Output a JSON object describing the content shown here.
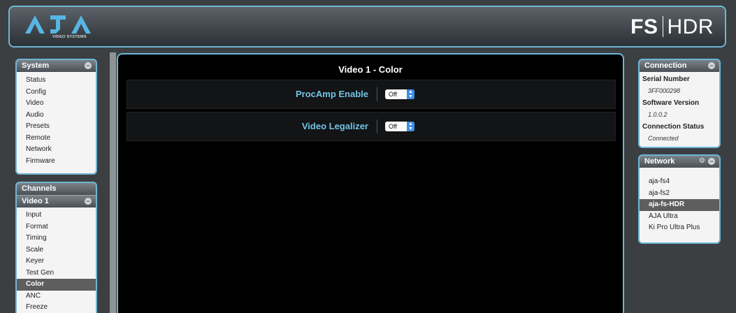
{
  "header": {
    "logo_text": "AJA",
    "logo_subtext": "VIDEO SYSTEMS",
    "product_main": "FS",
    "product_sub": "HDR"
  },
  "system_panel": {
    "title": "System",
    "items": [
      "Status",
      "Config",
      "Video",
      "Audio",
      "Presets",
      "Remote",
      "Network",
      "Firmware"
    ]
  },
  "channels_panel": {
    "title": "Channels",
    "sub_title": "Video 1",
    "items": [
      "Input",
      "Format",
      "Timing",
      "Scale",
      "Keyer",
      "Test Gen",
      "Color",
      "ANC",
      "Freeze"
    ],
    "active": "Color"
  },
  "main": {
    "title": "Video 1 - Color",
    "procamp": {
      "label": "ProcAmp Enable",
      "value": "Off"
    },
    "legalizer": {
      "label": "Video Legalizer",
      "value": "Off"
    }
  },
  "connection_panel": {
    "title": "Connection",
    "serial_label": "Serial Number",
    "serial_value": "3FF000298",
    "software_label": "Software Version",
    "software_value": "1.0.0.2",
    "status_label": "Connection Status",
    "status_value": "Connected"
  },
  "network_panel": {
    "title": "Network",
    "devices": [
      "aja-fs4",
      "aja-fs2",
      "aja-fs-HDR",
      "AJA Ultra",
      "Ki Pro Ultra Plus"
    ],
    "active": "aja-fs-HDR"
  },
  "colors": {
    "accent": "#6fb6d6",
    "label_blue": "#74c2e6",
    "select_blue": "#3c8fe8"
  }
}
